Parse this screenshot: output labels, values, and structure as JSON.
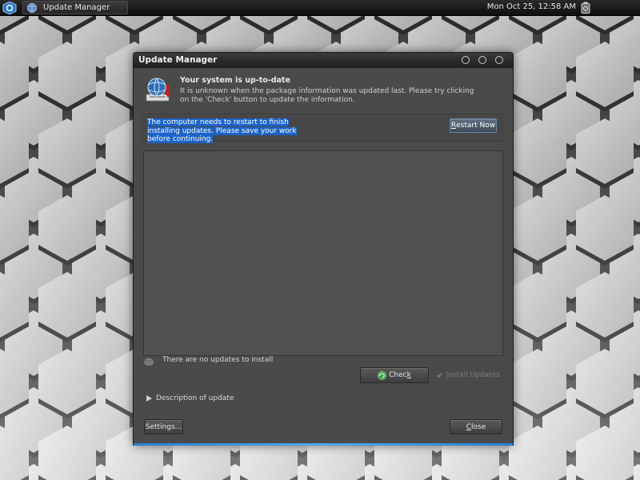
{
  "taskbar": {
    "task_title": "Update Manager",
    "clock": "Mon Oct 25, 12:58 AM"
  },
  "window": {
    "title": "Update Manager",
    "status_heading": "Your system is up-to-date",
    "status_description": "It is unknown when the package information was updated last. Please try clicking on the 'Check' button to update the information.",
    "restart_message": "The computer needs to restart to finish installing updates. Please save your work before continuing.",
    "restart_button": {
      "before": "",
      "mnemonic": "R",
      "after": "estart Now"
    },
    "no_updates_text": "There are no updates to install",
    "check_button": {
      "before": "Chec",
      "mnemonic": "k",
      "after": ""
    },
    "install_button": {
      "before": "",
      "mnemonic": "I",
      "after": "nstall Updates"
    },
    "description_toggle": "Description of update",
    "settings_button": "Settings...",
    "close_button": {
      "before": "",
      "mnemonic": "C",
      "after": "lose"
    }
  },
  "colors": {
    "selection": "#1c64c8",
    "window_bg": "#4a4a4a",
    "focus_glow": "#2a7fd1"
  },
  "icons": {
    "menu": "distro-logo-icon",
    "task": "update-manager-icon",
    "tray": "battery-icon",
    "status": "globe-update-icon",
    "no_updates": "package-icon",
    "check": "refresh-icon",
    "install": "checkmark-icon",
    "expander": "triangle-right-icon"
  }
}
